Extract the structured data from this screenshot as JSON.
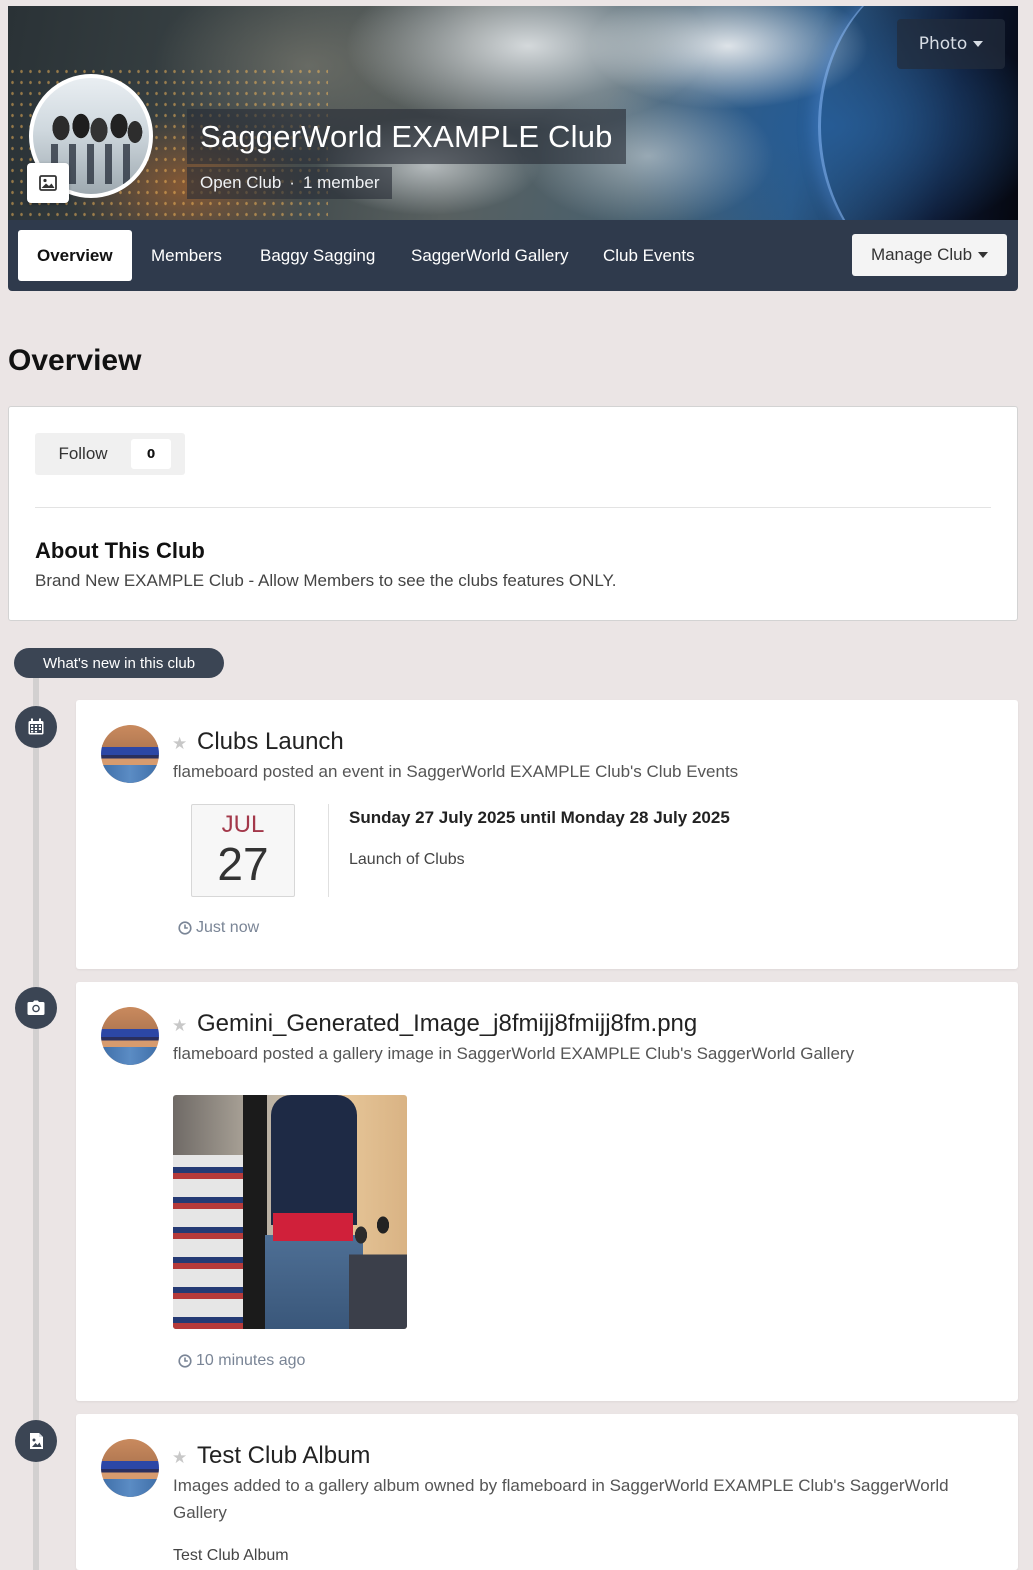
{
  "header": {
    "photo_button_label": "Photo",
    "club_name": "SaggerWorld EXAMPLE Club",
    "club_type": "Open Club",
    "meta_separator": "·",
    "member_count": "1 member"
  },
  "nav": {
    "tabs": [
      {
        "label": "Overview",
        "active": true
      },
      {
        "label": "Members",
        "active": false
      },
      {
        "label": "Baggy Sagging",
        "active": false
      },
      {
        "label": "SaggerWorld Gallery",
        "active": false
      },
      {
        "label": "Club Events",
        "active": false
      }
    ],
    "manage_label": "Manage Club"
  },
  "page": {
    "heading": "Overview"
  },
  "overview": {
    "follow_label": "Follow",
    "follow_count": "0",
    "about_title": "About This Club",
    "about_text": "Brand New EXAMPLE Club - Allow Members to see the clubs features ONLY."
  },
  "timeline": {
    "label": "What's new in this club",
    "items": [
      {
        "icon": "calendar-icon",
        "title": "Clubs Launch",
        "subtitle": "flameboard posted an event in SaggerWorld EXAMPLE Club's Club Events",
        "date_month": "JUL",
        "date_day": "27",
        "event_dates": "Sunday 27 July 2025 until Monday 28 July 2025",
        "event_desc": "Launch of Clubs",
        "time": "Just now"
      },
      {
        "icon": "camera-icon",
        "title": "Gemini_Generated_Image_j8fmijj8fmijj8fm.png",
        "subtitle": "flameboard posted a gallery image in SaggerWorld EXAMPLE Club's SaggerWorld Gallery",
        "time": "10 minutes ago"
      },
      {
        "icon": "image-file-icon",
        "title": "Test Club Album",
        "subtitle_line1": "Images added to a gallery album owned by flameboard in SaggerWorld EXAMPLE Club's SaggerWorld",
        "subtitle_line2": "Gallery",
        "detail": "Test Club Album"
      }
    ]
  },
  "colors": {
    "page_bg": "#ebe5e5",
    "tabbar_bg": "#2f3a4c",
    "timeline_icon_bg": "#3b4554",
    "date_month": "#a3384a",
    "time_text": "#7a8596"
  }
}
